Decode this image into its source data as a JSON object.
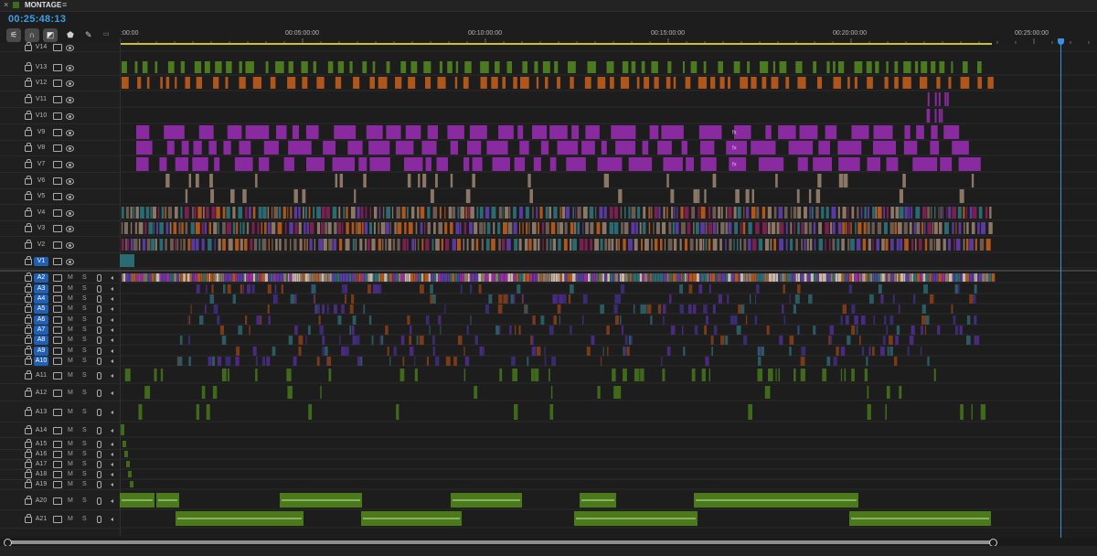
{
  "sequence": {
    "title": "MONTAGE",
    "timecode": "00:25:48:13",
    "close_glyph": "×",
    "menu_glyph": "≡",
    "icons": [
      "snap-icon",
      "linked-selection-icon",
      "add-marker-icon",
      "marker-icon",
      "wrench-icon",
      "captions-icon"
    ]
  },
  "ruler": {
    "labels": [
      ":00:00",
      "00:05:00:00",
      "00:10:00:00",
      "00:15:00:00",
      "00:20:00:00",
      "00:25:00:00"
    ]
  },
  "video_tracks": [
    {
      "name": "V14",
      "color": "#4b7a1f"
    },
    {
      "name": "V13",
      "color": "#4b7a1f"
    },
    {
      "name": "V12",
      "color": "#b0561a"
    },
    {
      "name": "V11",
      "color": "#8a2aa0"
    },
    {
      "name": "V10",
      "color": "#8a2aa0"
    },
    {
      "name": "V9",
      "color": "#8a2aa0"
    },
    {
      "name": "V8",
      "color": "#8a2aa0"
    },
    {
      "name": "V7",
      "color": "#8a2aa0"
    },
    {
      "name": "V6",
      "color": "#8c7766"
    },
    {
      "name": "V5",
      "color": "#8c7766"
    },
    {
      "name": "V4",
      "color": "#2a6a72"
    },
    {
      "name": "V3",
      "color": "#7a6a60"
    },
    {
      "name": "V2",
      "color": "#8c7766"
    },
    {
      "name": "V1",
      "color": "#2a6a72"
    }
  ],
  "audio_tracks": [
    {
      "name": "A2",
      "m": "M",
      "s": "S"
    },
    {
      "name": "A3",
      "m": "M",
      "s": "S"
    },
    {
      "name": "A4",
      "m": "M",
      "s": "S"
    },
    {
      "name": "A5",
      "m": "M",
      "s": "S"
    },
    {
      "name": "A6",
      "m": "M",
      "s": "S"
    },
    {
      "name": "A7",
      "m": "M",
      "s": "S"
    },
    {
      "name": "A8",
      "m": "M",
      "s": "S"
    },
    {
      "name": "A9",
      "m": "M",
      "s": "S"
    },
    {
      "name": "A10",
      "m": "M",
      "s": "S"
    },
    {
      "name": "A11",
      "m": "M",
      "s": "S"
    },
    {
      "name": "A12",
      "m": "M",
      "s": "S"
    },
    {
      "name": "A13",
      "m": "M",
      "s": "S"
    },
    {
      "name": "A14",
      "m": "M",
      "s": "S"
    },
    {
      "name": "A15",
      "m": "M",
      "s": "S"
    },
    {
      "name": "A16",
      "m": "M",
      "s": "S"
    },
    {
      "name": "A17",
      "m": "M",
      "s": "S"
    },
    {
      "name": "A18",
      "m": "M",
      "s": "S"
    },
    {
      "name": "A19",
      "m": "M",
      "s": "S"
    },
    {
      "name": "A20",
      "m": "M",
      "s": "S"
    },
    {
      "name": "A21",
      "m": "M",
      "s": "S"
    }
  ],
  "fx_label": "fx",
  "colors": {
    "playhead": "#3a8fe0",
    "work_area": "#c9c22a",
    "selected_track": "#1f5fb6",
    "music_clip": "#4a7a1a"
  }
}
